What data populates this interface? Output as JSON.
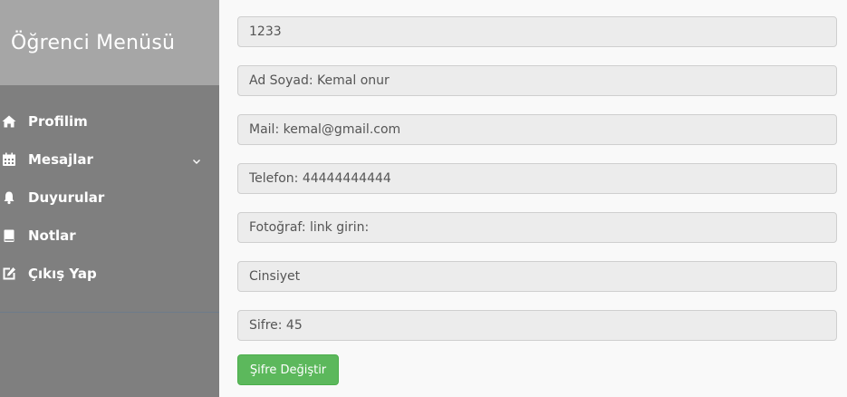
{
  "sidebar": {
    "title": "Öğrenci Menüsü",
    "items": [
      {
        "label": "Profilim",
        "icon": "home-icon"
      },
      {
        "label": "Mesajlar",
        "icon": "calendar-icon",
        "has_submenu": true
      },
      {
        "label": "Duyurular",
        "icon": "bell-icon"
      },
      {
        "label": "Notlar",
        "icon": "book-icon"
      },
      {
        "label": "Çıkış Yap",
        "icon": "edit-icon"
      }
    ]
  },
  "form": {
    "fields": [
      {
        "placeholder": "1233"
      },
      {
        "placeholder": "Ad Soyad: Kemal onur"
      },
      {
        "placeholder": "Mail: kemal@gmail.com"
      },
      {
        "placeholder": "Telefon: 44444444444"
      },
      {
        "placeholder": "Fotoğraf: link girin:"
      },
      {
        "placeholder": "Cinsiyet"
      },
      {
        "placeholder": "Sifre: 45"
      }
    ],
    "submit_label": "Şifre Değiştir"
  },
  "colors": {
    "sidebar_bg": "#7f7f7f",
    "sidebar_header_bg": "#a6a6a6",
    "button_bg": "#5cb85c",
    "page_bg": "#f9f9f9"
  }
}
